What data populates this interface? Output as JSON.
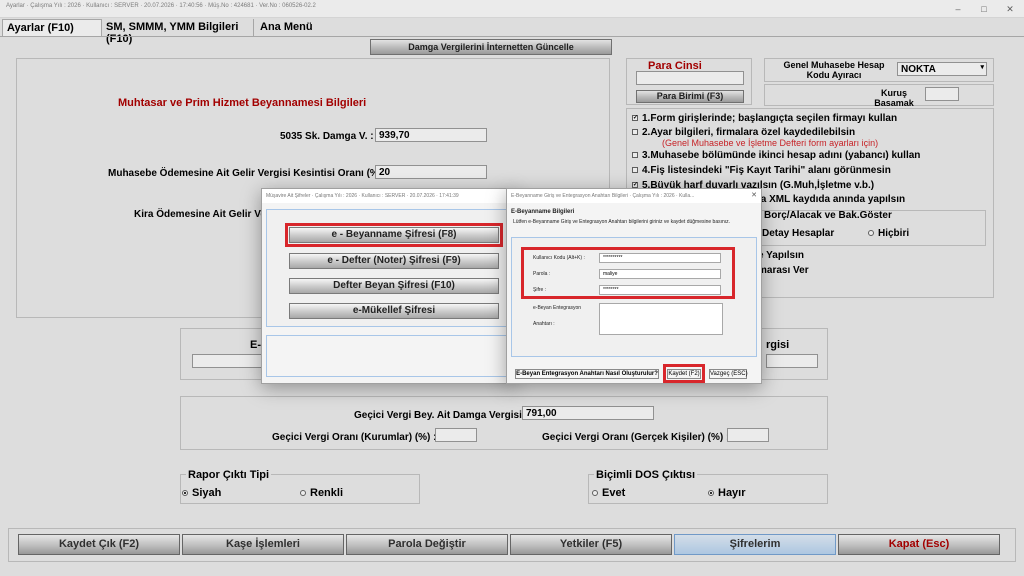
{
  "window": {
    "title": "Ayarlar  ·  Çalışma Yılı : 2026  ·  Kullanıcı : SERVER  ·  20.07.2026  ·  17:40:56  ·  Müş.No : 424681  ·  Ver.No : 060526-02.2",
    "min": "–",
    "max": "□",
    "close": "✕"
  },
  "tabs": [
    "Ayarlar (F10)",
    "SM, SMMM, YMM Bilgileri (F10)",
    "Ana Menü"
  ],
  "damga_button": "Damga Vergilerini İnternetten Güncelle",
  "muhtasar": {
    "title": "Muhtasar ve Prim Hizmet Beyannamesi Bilgileri",
    "damga_label": "5035 Sk. Damga V. :",
    "damga_value": "939,70",
    "stopaj_label": "Muhasebe Ödemesine Ait Gelir Vergisi Kesintisi Oranı (%) :",
    "stopaj_value": "20",
    "kira_label": "Kira Ödemesine Ait Gelir Ver"
  },
  "para": {
    "title": "Para Cinsi",
    "button": "Para Birimi (F3)"
  },
  "genel": {
    "label": "Genel Muhasebe Hesap Kodu Ayıracı",
    "value": "NOKTA",
    "kurus_label": "Kuruş Basamak"
  },
  "options": [
    {
      "text": "1.Form girişlerinde; başlangıçta seçilen firmayı kullan",
      "checked": true
    },
    {
      "text": "2.Ayar bilgileri, firmalara özel kaydedilebilsin",
      "checked": false
    },
    {
      "text": "(Genel Muhasebe ve İşletme Defteri form ayarları için)",
      "note": true
    },
    {
      "text": "3.Muhasebe bölümünde ikinci hesap adını (yabancı) kullan",
      "checked": false
    },
    {
      "text": "4.Fiş listesindeki \"Fiş Kayıt Tarihi\" alanı görünmesin",
      "checked": false
    },
    {
      "text": "5.Büyük harf duyarlı vazılsın (G.Muh,İşletme v.b.)",
      "checked": true
    },
    {
      "text": "la XML kaydıda anında yapılsın"
    }
  ],
  "borc": {
    "title": "Borç/Alacak ve Bak.Göster",
    "opt1": "Detay Hesaplar",
    "opt2": "Hiçbiri"
  },
  "hidden_rows": [
    "e Yapılsın",
    "marası Ver"
  ],
  "mid_labels": {
    "left": "E-",
    "right": "rgisi"
  },
  "gecici": {
    "damga_label": "Geçici Vergi Bey. Ait Damga Vergisi :",
    "damga_value": "791,00",
    "kurum_label": "Geçici Vergi Oranı (Kurumlar) (%) :",
    "gercek_label": "Geçici Vergi Oranı (Gerçek Kişiler) (%) :"
  },
  "rapor": {
    "title": "Rapor Çıktı Tipi",
    "opt1": "Siyah",
    "opt2": "Renkli"
  },
  "dos": {
    "title": "Biçimli DOS Çıktısı",
    "opt1": "Evet",
    "opt2": "Hayır"
  },
  "bottom_buttons": [
    "Kaydet Çık (F2)",
    "Kaşe İşlemleri",
    "Parola Değiştir",
    "Yetkiler (F5)",
    "Şifrelerim",
    "Kapat (Esc)"
  ],
  "dialog1": {
    "title": "Müşavire Ait Şifreler  ·  Çalışma Yılı : 2026  ·  Kullanıcı : SERVER  ·  20.07.2026  ·  17:41:39",
    "buttons": [
      "e - Beyanname Şifresi (F8)",
      "e - Defter (Noter) Şifresi (F9)",
      "Defter Beyan Şifresi (F10)",
      "e-Mükellef Şifresi"
    ]
  },
  "dialog2": {
    "title": "E-Beyanname Giriş ve Entegrasyon Anahtarı Bilgileri  ·  Çalışma Yılı : 2026  ·  Kulla...",
    "heading": "E-Beyanname Bilgileri",
    "desc": "Lütfen e-Beyanname Giriş ve Entegrasyon Anahtarı bilgilerini giriniz ve kaydet düğmesine basınız.",
    "user_label": "Kullanıcı Kodu (Alt+K) :",
    "user_value": "**********",
    "parola_label": "Parola :",
    "parola_value": "maliye",
    "sifre_label": "Şifre :",
    "sifre_value": "********",
    "anahtar_label1": "e-Beyan Entegrasyon",
    "anahtar_label2": "Anahtarı :",
    "howto": "E-Beyan Entegrasyon Anahtarı Nasıl Oluşturulur?",
    "save": "Kaydet (F2)",
    "cancel": "Vazgeç (ESC)"
  },
  "colors": {
    "red": "#d8262b",
    "dark_red": "#b00000",
    "highlight": "#bcd8f5"
  }
}
